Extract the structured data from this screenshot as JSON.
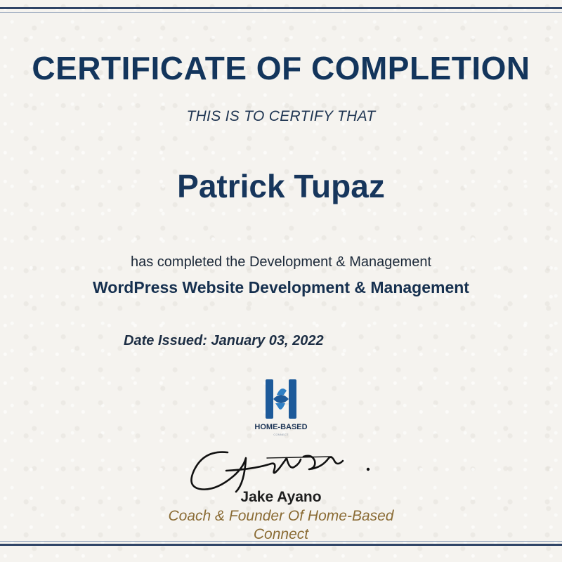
{
  "certificate": {
    "title": "CERTIFICATE OF COMPLETION",
    "subtitle": "THIS IS TO CERTIFY THAT",
    "recipient": "Patrick Tupaz",
    "completed_line": "has completed the Development & Management",
    "course": "WordPress Website Development & Management",
    "date_issued": "Date Issued: January 03, 2022"
  },
  "logo": {
    "name": "HOME-BASED",
    "tagline": "CONNECT"
  },
  "signer": {
    "name": "Jake Ayano",
    "title": "Coach & Founder Of Home-Based Connect"
  },
  "colors": {
    "title": "#13355c",
    "accent": "#8a6b34",
    "border": "#2f4466"
  }
}
